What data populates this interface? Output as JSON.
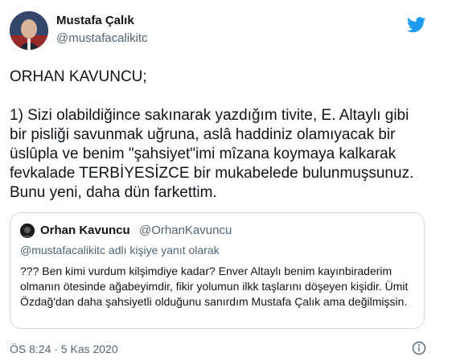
{
  "author": {
    "name": "Mustafa Çalık",
    "handle": "@mustafacalikitc"
  },
  "tweet": {
    "line1": "ORHAN KAVUNCU;",
    "line2": "1) Sizi olabildiğince sakınarak yazdığım tivite, E. Altaylı gibi bir pisliği savunmak uğruna, aslâ haddiniz olamıyacak bir üslûpla ve benim \"şahsiyet\"imi mîzana koymaya kalkarak fevkalade TERBİYESİZCE bir mukabelede bulunmuşsunuz. Bunu yeni, daha dün farkettim."
  },
  "quoted": {
    "name": "Orhan Kavuncu",
    "handle": "@OrhanKavuncu",
    "reply_to": "@mustafacalikitc adlı kişiye yanıt olarak",
    "text": "??? Ben kimi vurdum kilşimdiye kadar? Enver Altaylı benim kayınbiraderim olmanın ötesinde ağabeyimdir, fikir yolumun ilkk taşlarını döşeyen kişidir. Ümit Özdağ'dan daha şahsiyetli olduğunu sanırdım Mustafa Çalık ama değilmişsin."
  },
  "timestamp": "ÖS 8:24 · 5 Kas 2020",
  "icons": {
    "brand": "twitter-bird-icon",
    "info": "info-icon"
  },
  "colors": {
    "brand_blue": "#1d9bf0",
    "secondary_text": "#536471",
    "border": "#cfd9de"
  }
}
